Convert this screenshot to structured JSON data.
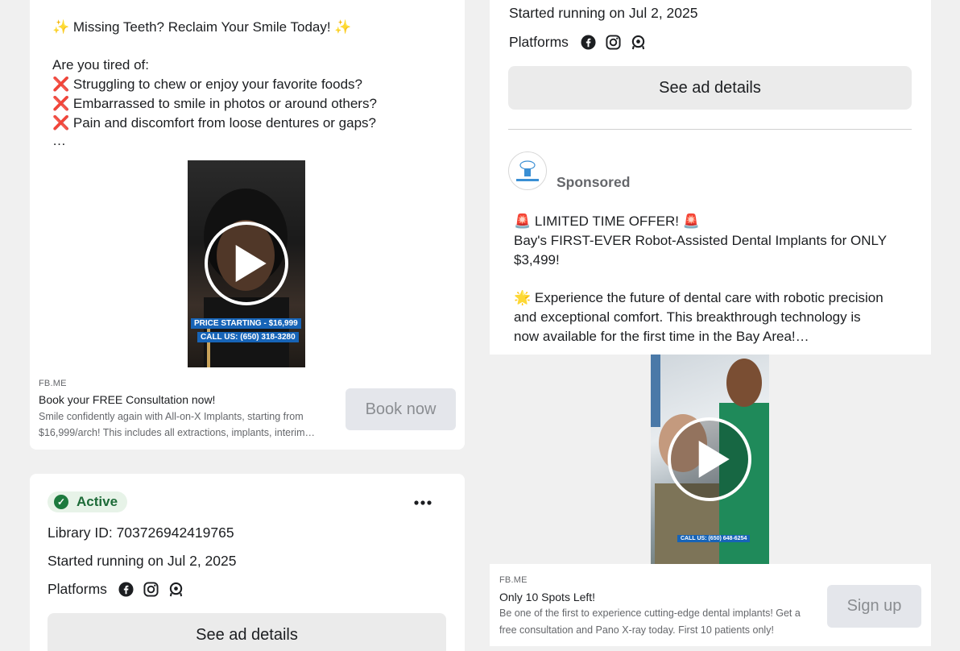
{
  "left_ad": {
    "body_lines": [
      "✨ Missing Teeth? Reclaim Your Smile Today! ✨",
      "",
      "Are you tired of:",
      "❌ Struggling to chew or enjoy your favorite foods?",
      "❌ Embarrassed to smile in photos or around others?",
      "❌ Pain and discomfort from loose dentures or gaps?",
      "…"
    ],
    "video_captions": [
      "PRICE STARTING - $16,999",
      "CALL US: (650) 318-3280"
    ],
    "link": {
      "source": "FB.ME",
      "title": "Book your FREE Consultation now!",
      "desc_lines": [
        "Smile confidently again with All-on-X Implants, starting from",
        "$16,999/arch! This includes all extractions, implants, interim…"
      ],
      "cta": "Book now"
    }
  },
  "left_status": {
    "badge": "Active",
    "more_icon": "more-dots-icon",
    "library_id": "Library ID: 703726942419765",
    "started": "Started running on Jul 2, 2025",
    "platforms_label": "Platforms",
    "platform_icons": [
      "facebook-icon",
      "instagram-icon",
      "audience-network-icon"
    ],
    "details_button": "See ad details"
  },
  "right_top": {
    "started": "Started running on Jul 2, 2025",
    "platforms_label": "Platforms",
    "platform_icons": [
      "facebook-icon",
      "instagram-icon",
      "audience-network-icon"
    ],
    "details_button": "See ad details",
    "sponsored": "Sponsored",
    "body_lines": [
      "🚨 LIMITED TIME OFFER! 🚨",
      "Bay's FIRST-EVER Robot-Assisted Dental Implants for ONLY",
      "$3,499!",
      "",
      "🌟 Experience the future of dental care with robotic precision",
      "and exceptional comfort. This breakthrough technology is",
      "now available for the first time in the Bay Area!…"
    ]
  },
  "right_ad": {
    "video_caption": "CALL US: (650) 648-6254",
    "link": {
      "source": "FB.ME",
      "title": "Only 10 Spots Left!",
      "desc_lines": [
        "Be one of the first to experience cutting-edge dental implants! Get a",
        "free consultation and Pano X-ray today. First 10 patients only!"
      ],
      "cta": "Sign up"
    }
  },
  "colors": {
    "background": "#f0f0f0",
    "active_green": "#1d7a3e",
    "caption_blue": "#1764b7"
  }
}
